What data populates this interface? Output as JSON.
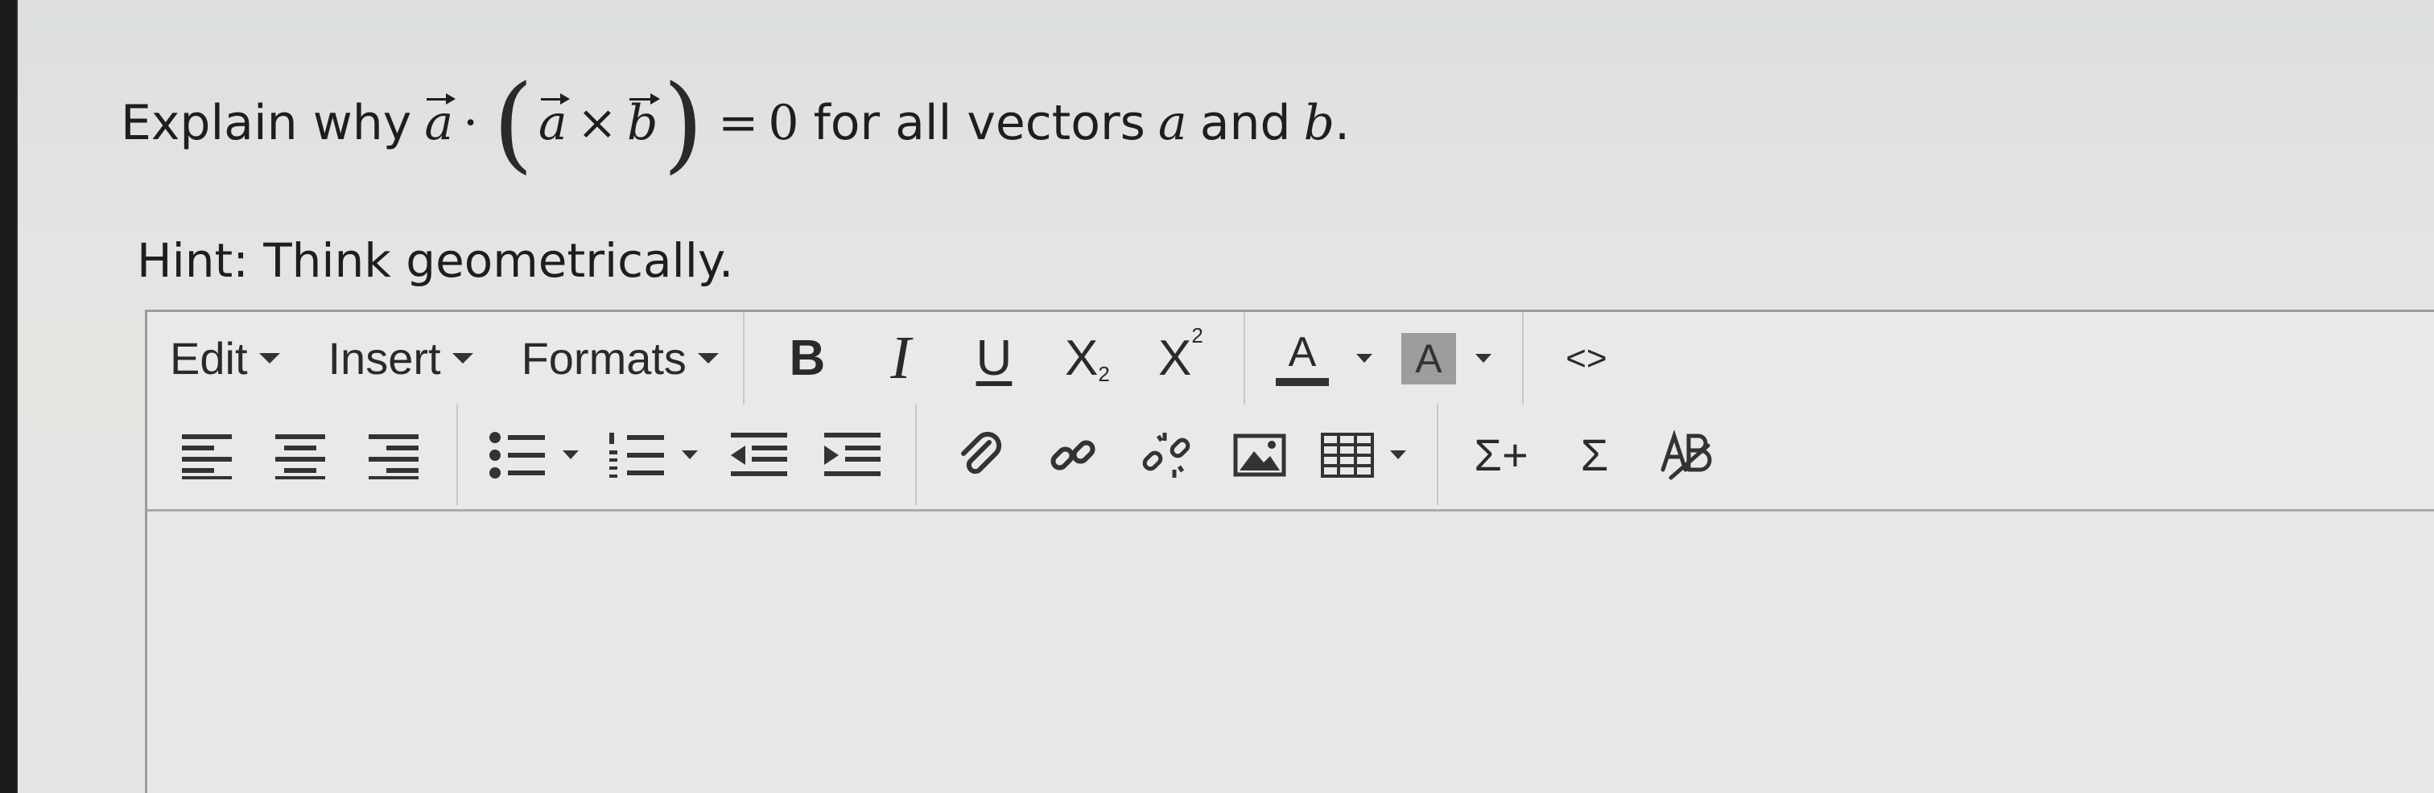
{
  "question": {
    "prefix": "Explain why",
    "vec_a": "a",
    "dot": "·",
    "vec_a2": "a",
    "cross": "×",
    "vec_b": "b",
    "equals": "=",
    "zero": "0",
    "suffix_mid": "for all vectors",
    "var_a": "a",
    "and": "and",
    "var_b": "b",
    "period": "."
  },
  "hint": "Hint: Think geometrically.",
  "toolbar": {
    "menus": [
      "Edit",
      "Insert",
      "Formats"
    ],
    "bold": "B",
    "italic": "I",
    "underline": "U",
    "subscript": "X",
    "subscript_mark": "2",
    "superscript": "X",
    "superscript_mark": "2",
    "text_color": "A",
    "bg_color": "A",
    "code": "<>",
    "sigma_plus": "Σ+",
    "sigma": "Σ"
  },
  "editor": {
    "content": ""
  }
}
